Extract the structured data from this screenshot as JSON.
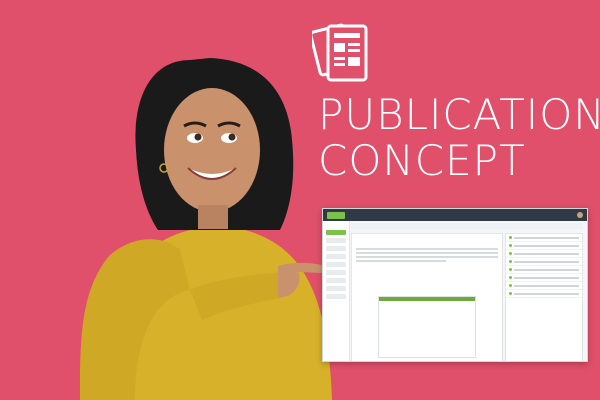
{
  "headline": {
    "line1": "PUBLICATION",
    "line2": "CONCEPT"
  },
  "colors": {
    "background": "#e0506a",
    "accent": "#7cc14a"
  },
  "icons": {
    "publication": "newspaper-icon"
  }
}
